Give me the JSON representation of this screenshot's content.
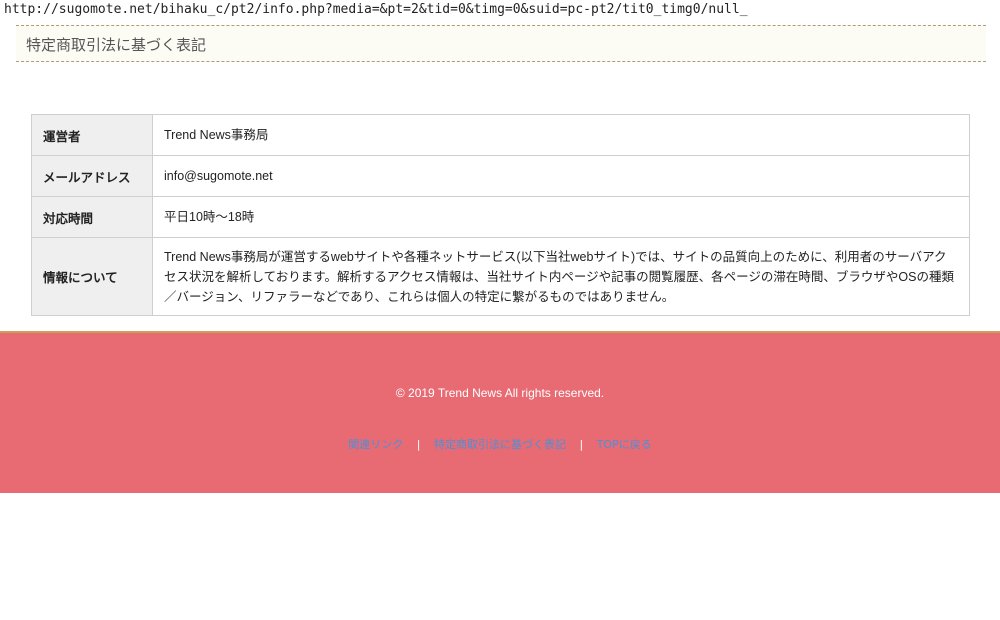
{
  "url": "http://sugomote.net/bihaku_c/pt2/info.php?media=&pt=2&tid=0&timg=0&suid=pc-pt2/tit0_timg0/null_",
  "page_title": "特定商取引法に基づく表記",
  "table": {
    "rows": [
      {
        "label": "運営者",
        "value": "Trend News事務局"
      },
      {
        "label": "メールアドレス",
        "value": "info@sugomote.net"
      },
      {
        "label": "対応時間",
        "value": "平日10時～18時"
      },
      {
        "label": "情報について",
        "value": "Trend News事務局が運営するwebサイトや各種ネットサービス(以下当社webサイト)では、サイトの品質向上のために、利用者のサーバアクセス状況を解析しております。解析するアクセス情報は、当社サイト内ページや記事の閲覧履歴、各ページの滞在時間、ブラウザやOSの種類／バージョン、リファラーなどであり、これらは個人の特定に繋がるものではありません。"
      }
    ]
  },
  "footer": {
    "copyright": "© 2019 Trend News All rights reserved.",
    "links": [
      {
        "label": "関連リンク"
      },
      {
        "label": "特定商取引法に基づく表記"
      },
      {
        "label": "TOPに戻る"
      }
    ],
    "separator": "|"
  },
  "colors": {
    "footer_bg": "#e86b74",
    "link": "#4a90d9",
    "header_bg": "#fcfcf5"
  }
}
